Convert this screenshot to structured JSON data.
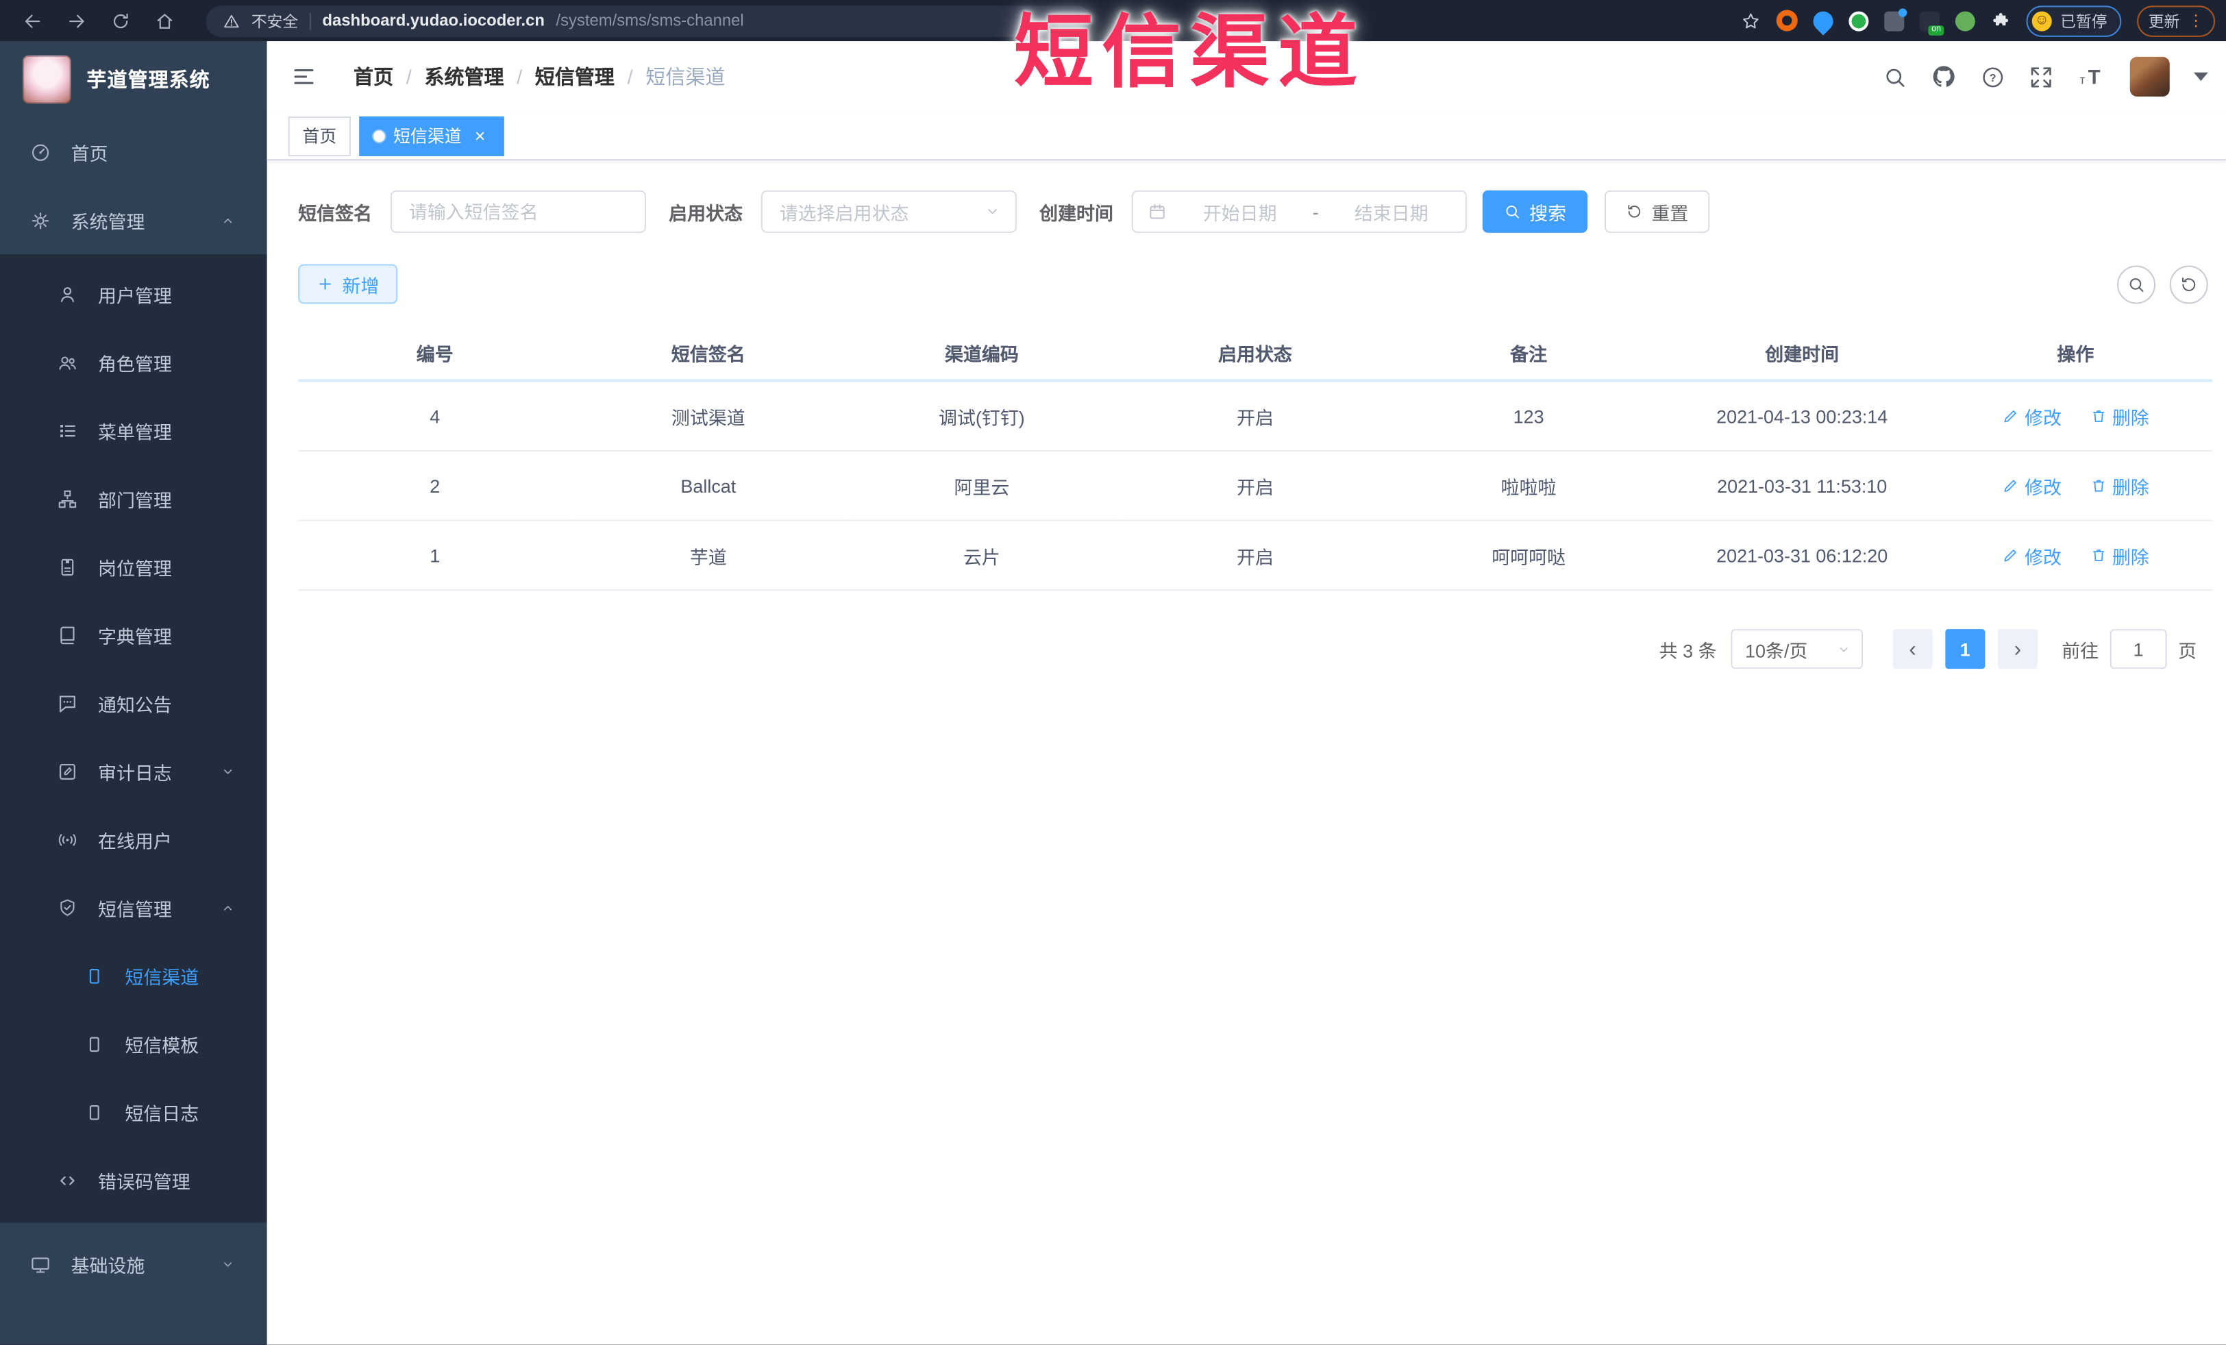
{
  "browser": {
    "security_label": "不安全",
    "url_host": "dashboard.yudao.iocoder.cn",
    "url_path": "/system/sms/sms-channel",
    "paused_badge": "已暂停",
    "update_button": "更新"
  },
  "overlay_title": "短信渠道",
  "icons": {
    "close": "×",
    "slash": "/",
    "prev": "‹",
    "next": "›",
    "face": "☺",
    "ellipsis": "⋮",
    "range_dash": "-"
  },
  "sidebar": {
    "title": "芋道管理系统",
    "items": [
      {
        "label": "首页"
      },
      {
        "label": "系统管理"
      },
      {
        "label": "用户管理"
      },
      {
        "label": "角色管理"
      },
      {
        "label": "菜单管理"
      },
      {
        "label": "部门管理"
      },
      {
        "label": "岗位管理"
      },
      {
        "label": "字典管理"
      },
      {
        "label": "通知公告"
      },
      {
        "label": "审计日志"
      },
      {
        "label": "在线用户"
      },
      {
        "label": "短信管理"
      },
      {
        "label": "短信渠道"
      },
      {
        "label": "短信模板"
      },
      {
        "label": "短信日志"
      },
      {
        "label": "错误码管理"
      },
      {
        "label": "基础设施"
      }
    ]
  },
  "header": {
    "breadcrumb": [
      "首页",
      "系统管理",
      "短信管理",
      "短信渠道"
    ]
  },
  "tabs": [
    {
      "label": "首页"
    },
    {
      "label": "短信渠道"
    }
  ],
  "filters": {
    "sign_label": "短信签名",
    "sign_placeholder": "请输入短信签名",
    "status_label": "启用状态",
    "status_placeholder": "请选择启用状态",
    "time_label": "创建时间",
    "start_placeholder": "开始日期",
    "end_placeholder": "结束日期",
    "search_label": "搜索",
    "reset_label": "重置"
  },
  "toolbar": {
    "add_label": "新增"
  },
  "table": {
    "columns": [
      "编号",
      "短信签名",
      "渠道编码",
      "启用状态",
      "备注",
      "创建时间",
      "操作"
    ],
    "edit_label": "修改",
    "delete_label": "删除",
    "rows": [
      {
        "id": "4",
        "sign": "测试渠道",
        "code": "调试(钉钉)",
        "status": "开启",
        "remark": "123",
        "created": "2021-04-13 00:23:14"
      },
      {
        "id": "2",
        "sign": "Ballcat",
        "code": "阿里云",
        "status": "开启",
        "remark": "啦啦啦",
        "created": "2021-03-31 11:53:10"
      },
      {
        "id": "1",
        "sign": "芋道",
        "code": "云片",
        "status": "开启",
        "remark": "呵呵呵哒",
        "created": "2021-03-31 06:12:20"
      }
    ]
  },
  "pagination": {
    "total": "共 3 条",
    "page_size": "10条/页",
    "current_page": "1",
    "goto_label": "前往",
    "goto_value": "1",
    "page_suffix": "页"
  }
}
